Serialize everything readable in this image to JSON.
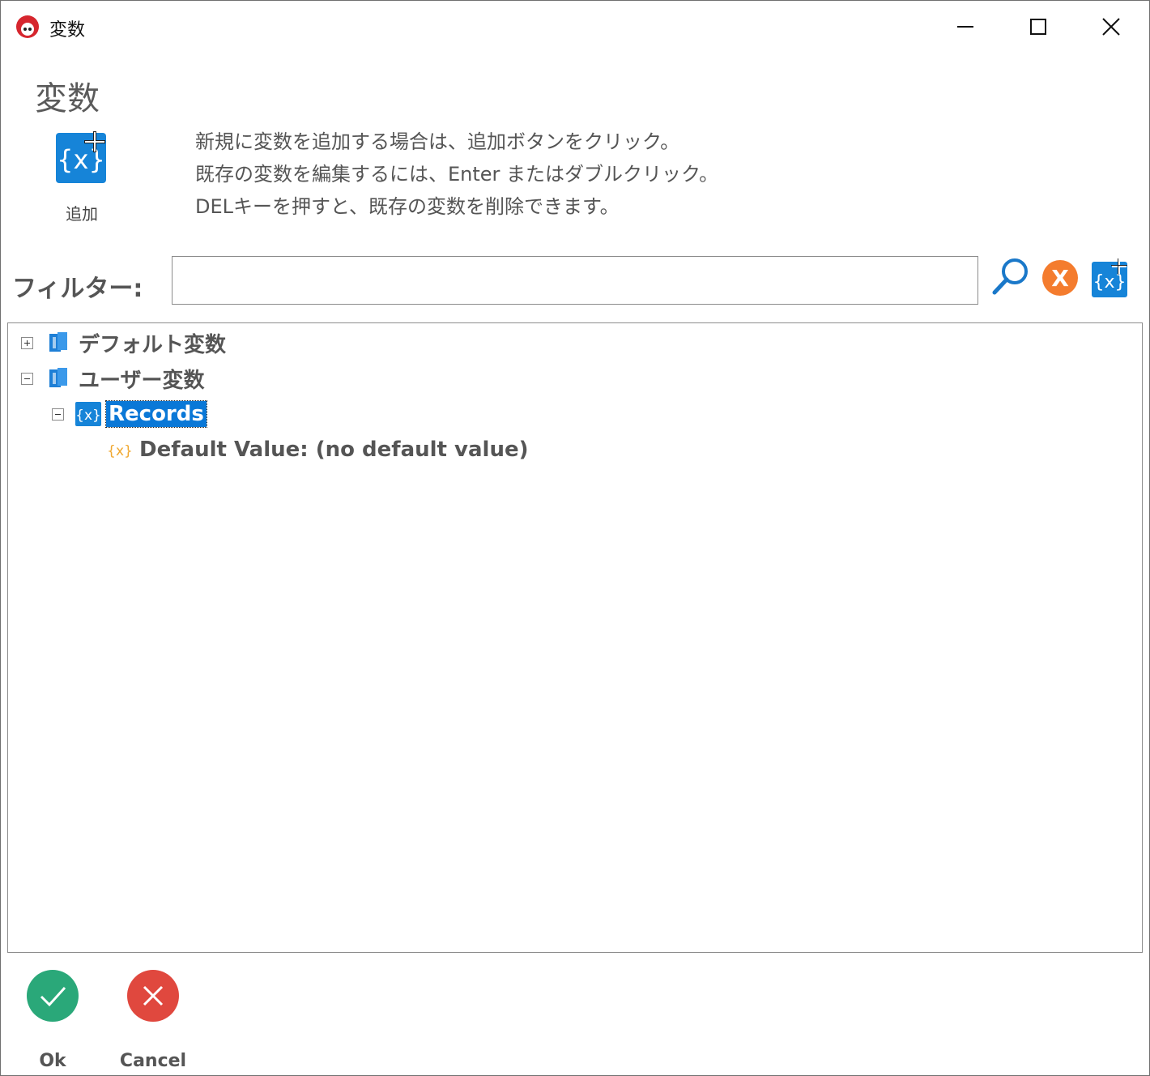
{
  "window": {
    "title": "変数"
  },
  "header": {
    "title": "変数",
    "add_label": "追加"
  },
  "help": {
    "lines": [
      "新規に変数を追加する場合は、追加ボタンをクリック。",
      "既存の変数を編集するには、Enter またはダブルクリック。",
      "DELキーを押すと、既存の変数を削除できます。"
    ]
  },
  "filter": {
    "label": "フィルター:",
    "value": "",
    "placeholder": ""
  },
  "tree": {
    "nodes": [
      {
        "label": "デフォルト変数",
        "expanded": false
      },
      {
        "label": "ユーザー変数",
        "expanded": true
      },
      {
        "label": "Records",
        "expanded": true,
        "selected": true
      },
      {
        "label": "Default Value: (no default value)"
      }
    ]
  },
  "footer": {
    "ok_label": "Ok",
    "cancel_label": "Cancel"
  },
  "colors": {
    "accent_blue": "#0a78d7",
    "ok_green": "#2aa879",
    "cancel_red": "#e0483e",
    "clear_orange": "#f47c2e"
  }
}
